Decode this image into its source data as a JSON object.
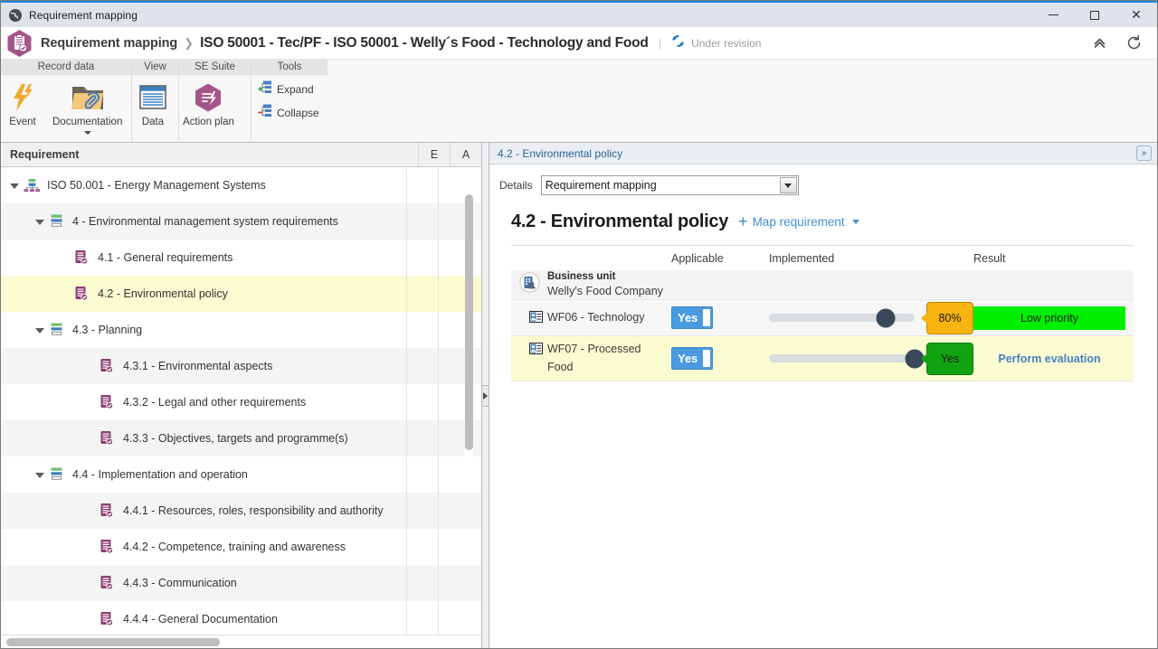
{
  "window": {
    "title": "Requirement mapping",
    "app_icon": "globe-icon",
    "minimize": "—",
    "maximize": "□",
    "close": "✕"
  },
  "header": {
    "breadcrumb_app": "Requirement mapping",
    "separator": "❯",
    "breadcrumb_current": "ISO 50001 - Tec/PF - ISO 50001 - Welly´s Food - Technology and Food",
    "pipe": "|",
    "status": "Under revision",
    "collapse_icon": "chevron-double-up-icon",
    "refresh_icon": "refresh-icon"
  },
  "ribbon": {
    "groups": [
      {
        "title": "Record data",
        "buttons": [
          {
            "label": "Event",
            "icon": "lightning-bolt-icon",
            "has_caret": false
          },
          {
            "label": "Documentation",
            "icon": "folder-attachment-icon",
            "has_caret": true
          }
        ]
      },
      {
        "title": "View",
        "buttons": [
          {
            "label": "Data",
            "icon": "data-table-icon",
            "has_caret": false
          }
        ]
      },
      {
        "title": "SE Suite",
        "buttons": [
          {
            "label": "Action plan",
            "icon": "action-plan-hexagon-icon",
            "has_caret": false
          }
        ]
      },
      {
        "title": "Tools",
        "small_buttons": [
          {
            "label": "Expand",
            "icon": "expand-tree-icon"
          },
          {
            "label": "Collapse",
            "icon": "collapse-tree-icon"
          }
        ]
      }
    ]
  },
  "tree": {
    "columns": {
      "requirement": "Requirement",
      "e": "E",
      "a": "A"
    },
    "rows": [
      {
        "label": "ISO 50.001 - Energy Management Systems",
        "depth": 0,
        "icon": "org-structure-icon",
        "expander": "expanded",
        "shade": "white"
      },
      {
        "label": "4 - Environmental management system requirements",
        "depth": 1,
        "icon": "section-icon",
        "expander": "expanded",
        "shade": "alt"
      },
      {
        "label": "4.1 - General requirements",
        "depth": 2,
        "icon": "requirement-doc-icon",
        "expander": "none",
        "shade": "white"
      },
      {
        "label": "4.2 - Environmental policy",
        "depth": 2,
        "icon": "requirement-doc-icon",
        "expander": "none",
        "shade": "selected"
      },
      {
        "label": "4.3 - Planning",
        "depth": 1,
        "icon": "section-icon",
        "expander": "expanded",
        "shade": "white"
      },
      {
        "label": "4.3.1 - Environmental aspects",
        "depth": 3,
        "icon": "requirement-doc-icon",
        "expander": "none",
        "shade": "alt"
      },
      {
        "label": "4.3.2 - Legal and other requirements",
        "depth": 3,
        "icon": "requirement-doc-icon",
        "expander": "none",
        "shade": "white"
      },
      {
        "label": "4.3.3 - Objectives, targets and programme(s)",
        "depth": 3,
        "icon": "requirement-doc-icon",
        "expander": "none",
        "shade": "alt"
      },
      {
        "label": "4.4 - Implementation and operation",
        "depth": 1,
        "icon": "section-icon",
        "expander": "expanded",
        "shade": "white"
      },
      {
        "label": "4.4.1 - Resources, roles, responsibility and authority",
        "depth": 3,
        "icon": "requirement-doc-icon",
        "expander": "none",
        "shade": "alt"
      },
      {
        "label": "4.4.2 - Competence, training and awareness",
        "depth": 3,
        "icon": "requirement-doc-icon",
        "expander": "none",
        "shade": "white"
      },
      {
        "label": "4.4.3 - Communication",
        "depth": 3,
        "icon": "requirement-doc-icon",
        "expander": "none",
        "shade": "alt"
      },
      {
        "label": "4.4.4 - General Documentation",
        "depth": 3,
        "icon": "requirement-doc-icon",
        "expander": "none",
        "shade": "white"
      }
    ]
  },
  "detail": {
    "tab_title": "4.2 - Environmental policy",
    "expand_panel_icon": "chevron-double-right-icon",
    "details_label": "Details",
    "details_value": "Requirement mapping",
    "page_title": "4.2 - Environmental policy",
    "map_requirement_label": "Map requirement",
    "map_requirement_plus": "+",
    "grid": {
      "columns": {
        "name": "",
        "applicable": "Applicable",
        "implemented": "Implemented",
        "result": "Result"
      },
      "business_unit": {
        "caption": "Business unit",
        "name": "Welly's Food Company",
        "icon": "business-unit-icon"
      },
      "rows": [
        {
          "name": "WF06 - Technology",
          "icon": "contact-card-icon",
          "applicable": "Yes",
          "implemented_percent": 80,
          "bubble_text": "80%",
          "bubble_color": "#f9b411",
          "result_text": "Low priority",
          "result_color": "#00f000",
          "result_type": "badge",
          "shade": "alt"
        },
        {
          "name": "WF07 - Processed Food",
          "icon": "contact-card-icon",
          "applicable": "Yes",
          "implemented_percent": 100,
          "bubble_text": "Yes",
          "bubble_color": "#12a312",
          "result_text": "Perform evaluation",
          "result_color": "#4a7fc1",
          "result_type": "link",
          "shade": "selected"
        }
      ]
    }
  },
  "colors": {
    "accent_blue": "#1a8cdd",
    "brand_purple": "#a04d86",
    "selected_row": "#fbfbd2",
    "link_blue": "#3f8fd0"
  }
}
